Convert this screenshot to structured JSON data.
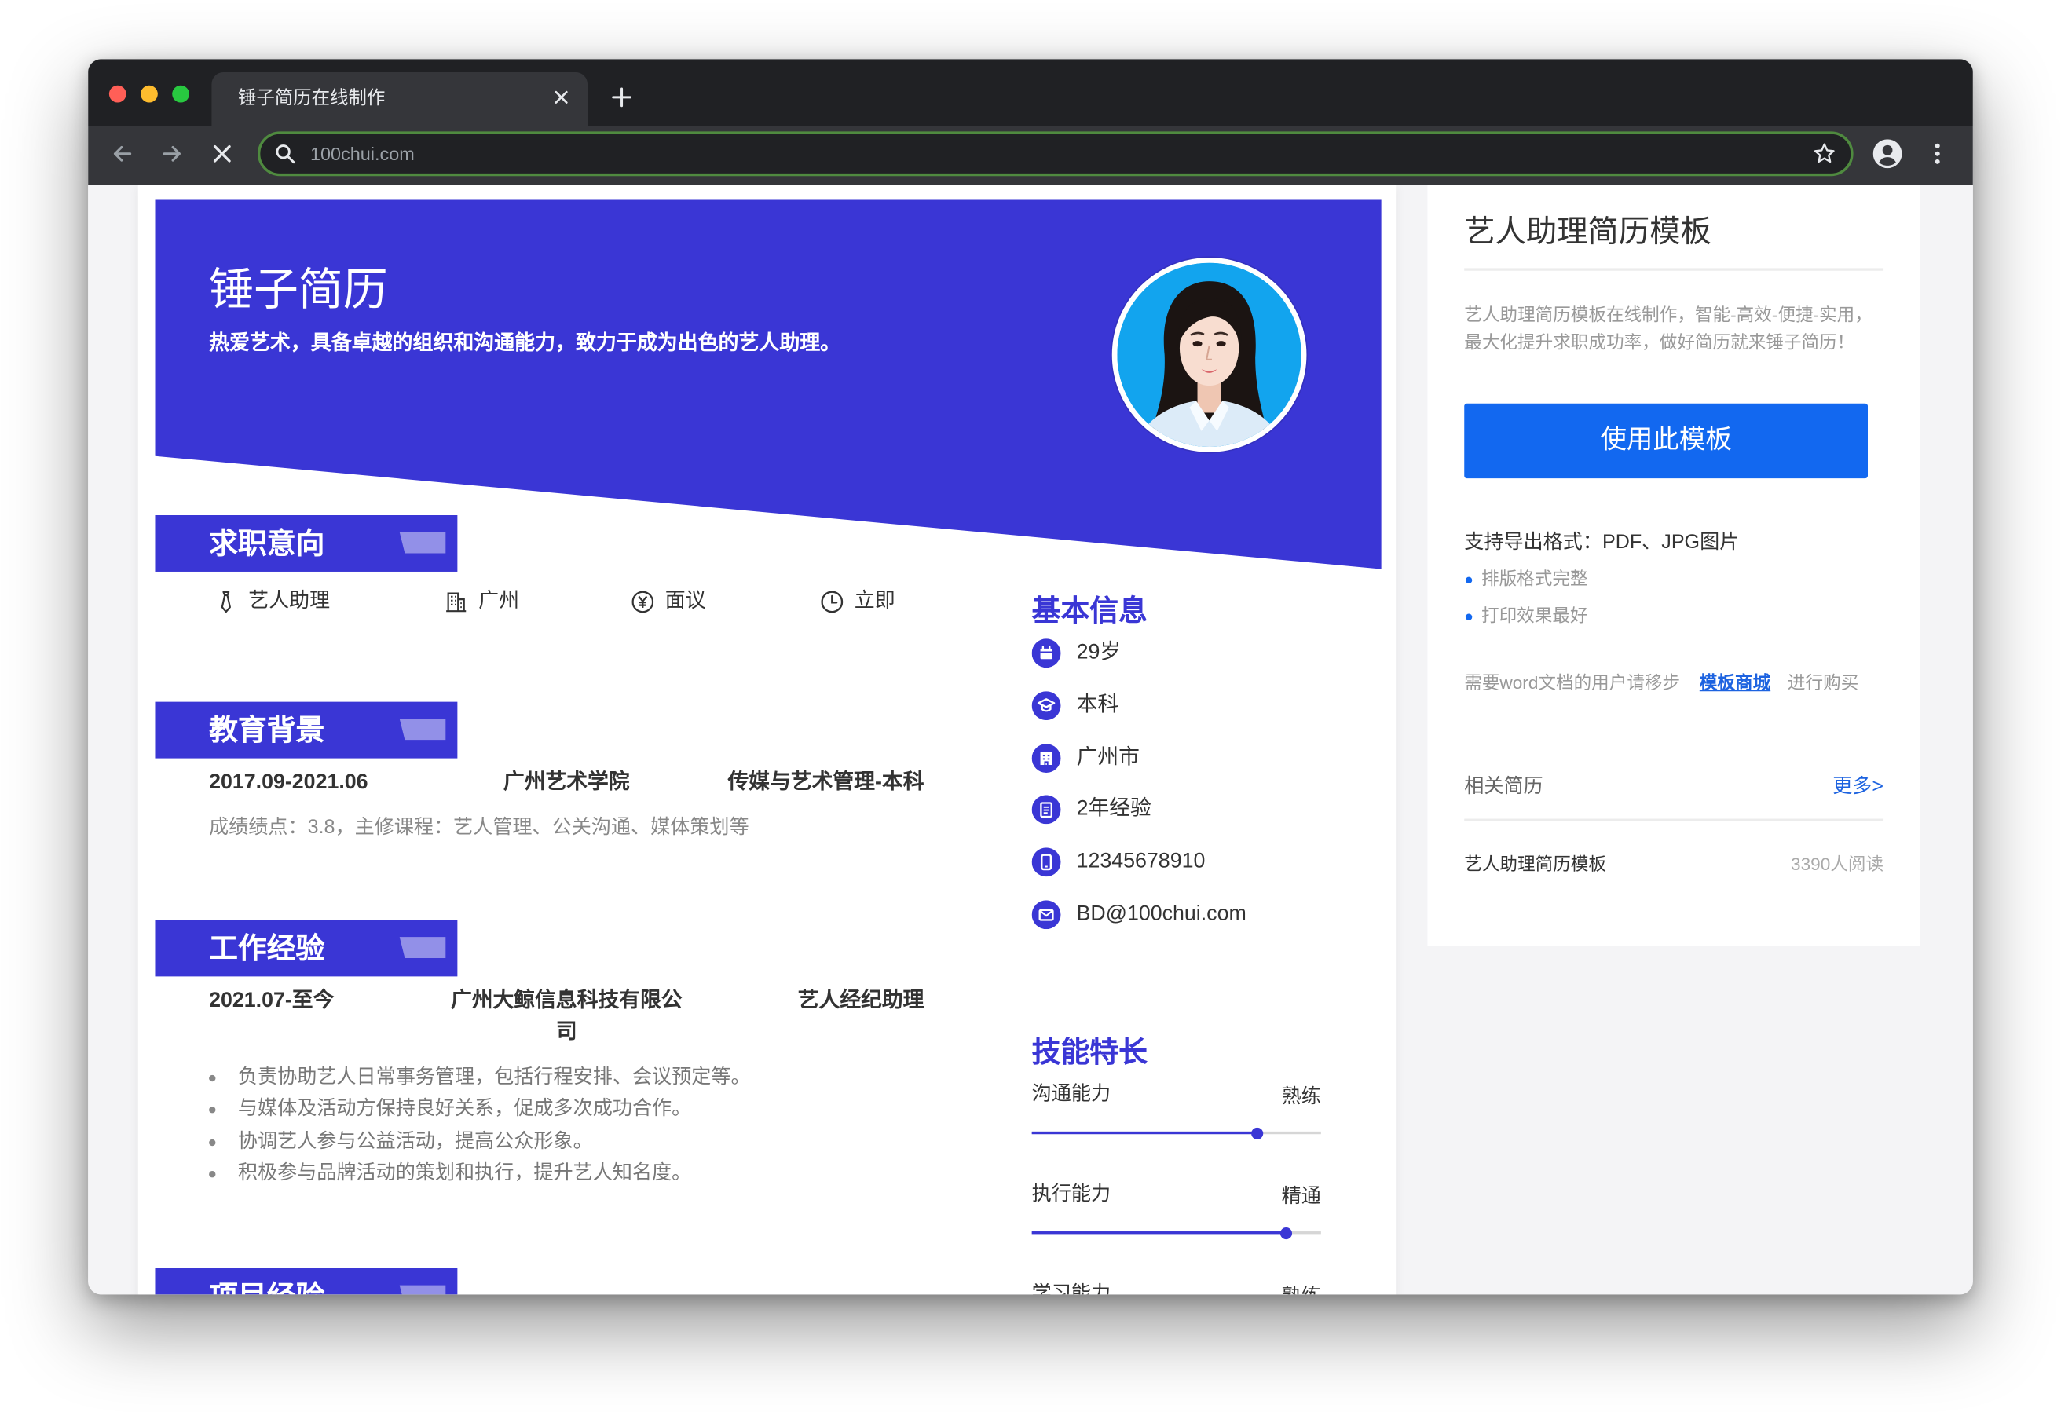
{
  "browser": {
    "tab_title": "锤子简历在线制作",
    "url": "100chui.com"
  },
  "colors": {
    "resume_accent": "#3a36d5",
    "button_blue": "#1268f0",
    "link_blue": "#1d63e0",
    "chrome_dark": "#202124",
    "chrome_toolbar": "#35363a"
  },
  "resume": {
    "name": "锤子简历",
    "tagline": "热爱艺术，具备卓越的组织和沟通能力，致力于成为出色的艺人助理。",
    "intention": {
      "title": "求职意向",
      "items": [
        {
          "icon": "tie-icon",
          "text": "艺人助理"
        },
        {
          "icon": "building-icon",
          "text": "广州"
        },
        {
          "icon": "yen-icon",
          "text": "面议"
        },
        {
          "icon": "clock-icon",
          "text": "立即"
        }
      ]
    },
    "education": {
      "title": "教育背景",
      "period": "2017.09-2021.06",
      "school": "广州艺术学院",
      "major": "传媒与艺术管理-本科",
      "detail": "成绩绩点：3.8，主修课程：艺人管理、公关沟通、媒体策划等"
    },
    "work": {
      "title": "工作经验",
      "period": "2021.07-至今",
      "company": "广州大鲸信息科技有限公司",
      "position": "艺人经纪助理",
      "duties": [
        "负责协助艺人日常事务管理，包括行程安排、会议预定等。",
        "与媒体及活动方保持良好关系，促成多次成功合作。",
        "协调艺人参与公益活动，提高公众形象。",
        "积极参与品牌活动的策划和执行，提升艺人知名度。"
      ]
    },
    "project": {
      "title": "项目经验"
    },
    "basic_info": {
      "title": "基本信息",
      "items": [
        {
          "icon": "calendar-icon",
          "text": "29岁"
        },
        {
          "icon": "graduation-cap-icon",
          "text": "本科"
        },
        {
          "icon": "building-icon",
          "text": "广州市"
        },
        {
          "icon": "document-icon",
          "text": "2年经验"
        },
        {
          "icon": "phone-icon",
          "text": "12345678910"
        },
        {
          "icon": "mail-icon",
          "text": "BD@100chui.com"
        }
      ]
    },
    "skills": {
      "title": "技能特长",
      "items": [
        {
          "name": "沟通能力",
          "level_text": "熟练",
          "level": 0.78
        },
        {
          "name": "执行能力",
          "level_text": "精通",
          "level": 0.88
        },
        {
          "name": "学习能力",
          "level_text": "熟练"
        }
      ]
    }
  },
  "sidebar": {
    "title": "艺人助理简历模板",
    "description_lines": [
      "艺人助理简历模板在线制作，智能-高效-便捷-实用，",
      "最大化提升求职成功率，做好简历就来锤子简历！"
    ],
    "use_button": "使用此模板",
    "export_formats": "支持导出格式：PDF、JPG图片",
    "features": [
      "排版格式完整",
      "打印效果最好"
    ],
    "word_notice": {
      "before": "需要word文档的用户请移步",
      "link": "模板商城",
      "after": "进行购买"
    },
    "related": {
      "title": "相关简历",
      "more": "更多>",
      "items": [
        {
          "title": "艺人助理简历模板",
          "reads": "3390人阅读"
        }
      ]
    }
  }
}
